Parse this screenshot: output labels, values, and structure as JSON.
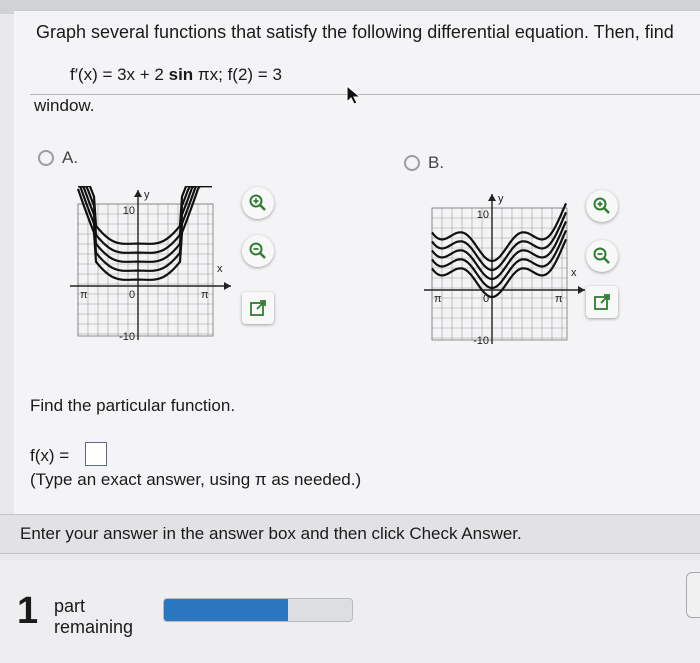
{
  "question": {
    "prompt": "Graph several functions that satisfy the following differential equation. Then, find",
    "equation_lhs": "f′(x) = 3x + 2 ",
    "equation_sin": "sin",
    "equation_rhs": " πx; f(2) = 3",
    "window_text": "window."
  },
  "options": [
    {
      "letter": "A.",
      "selected": false,
      "y_tick_top": "10",
      "y_tick_bottom": "-10",
      "x_tick_left": "π",
      "x_tick_right": "π",
      "x_axis_label": "x",
      "y_axis_label": "y",
      "origin_label": "0"
    },
    {
      "letter": "B.",
      "selected": false,
      "y_tick_top": "10",
      "y_tick_bottom": "-10",
      "x_tick_left": "π",
      "x_tick_right": "π",
      "x_axis_label": "x",
      "y_axis_label": "y",
      "origin_label": "0"
    }
  ],
  "answer": {
    "find_text": "Find the particular function.",
    "fx_label": "f(x) =",
    "value": "",
    "hint": "(Type an exact answer, using π as needed.)"
  },
  "instruction": "Enter your answer in the answer box and then click Check Answer.",
  "footer": {
    "parts_count": "1",
    "parts_label_line1": "part",
    "parts_label_line2": "remaining",
    "progress_fraction": 0.66,
    "progress_color": "#2a77c0"
  }
}
